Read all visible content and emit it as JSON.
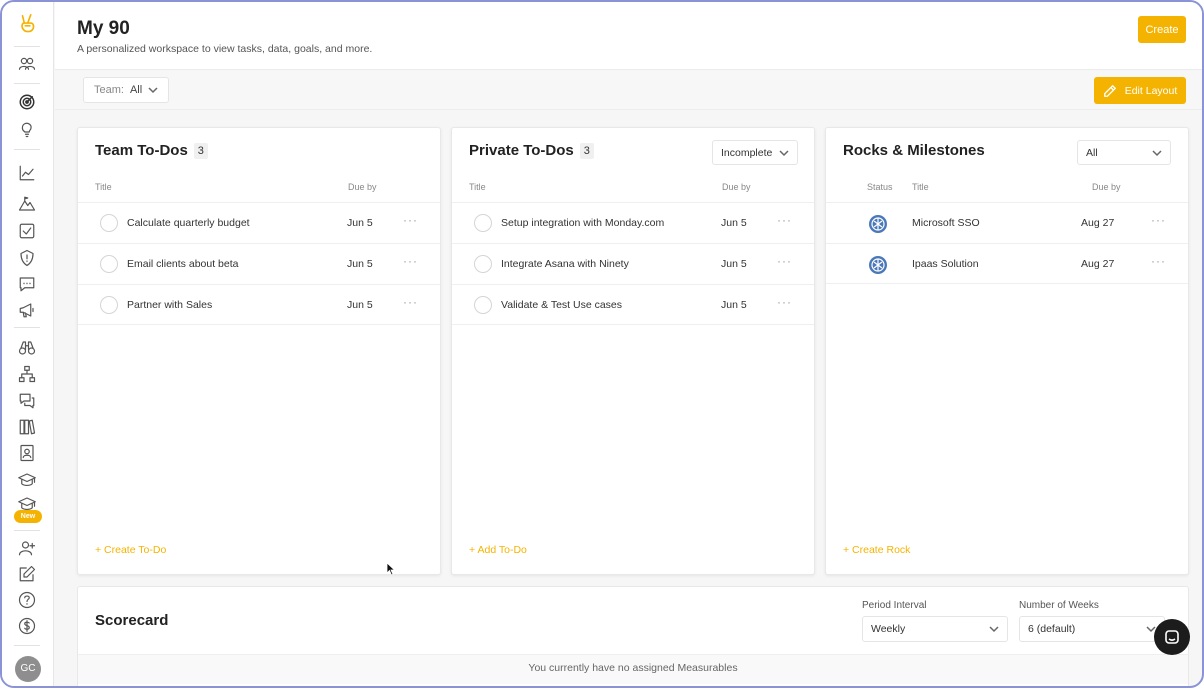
{
  "header": {
    "title": "My 90",
    "subtitle": "A personalized workspace to view tasks, data, goals, and more.",
    "create_label": "Create"
  },
  "filter": {
    "team_label": "Team:",
    "team_value": "All",
    "edit_layout_label": "Edit Layout"
  },
  "sidebar": {
    "new_badge": "New",
    "avatar_initials": "GC"
  },
  "team_todos": {
    "title": "Team To-Dos",
    "count": "3",
    "col_title": "Title",
    "col_due": "Due by",
    "rows": [
      {
        "title": "Calculate quarterly budget",
        "due": "Jun 5"
      },
      {
        "title": "Email clients about beta",
        "due": "Jun 5"
      },
      {
        "title": "Partner with Sales",
        "due": "Jun 5"
      }
    ],
    "add_label": "+ Create To-Do"
  },
  "private_todos": {
    "title": "Private To-Dos",
    "count": "3",
    "filter_value": "Incomplete",
    "col_title": "Title",
    "col_due": "Due by",
    "rows": [
      {
        "title": "Setup integration with Monday.com",
        "due": "Jun 5"
      },
      {
        "title": "Integrate Asana with Ninety",
        "due": "Jun 5"
      },
      {
        "title": "Validate & Test Use cases",
        "due": "Jun 5"
      }
    ],
    "add_label": "+ Add To-Do"
  },
  "rocks": {
    "title": "Rocks & Milestones",
    "filter_value": "All",
    "col_status": "Status",
    "col_title": "Title",
    "col_due": "Due by",
    "rows": [
      {
        "title": "Microsoft SSO",
        "due": "Aug 27"
      },
      {
        "title": "Ipaas Solution",
        "due": "Aug 27"
      }
    ],
    "add_label": "+ Create Rock"
  },
  "scorecard": {
    "title": "Scorecard",
    "period_label": "Period Interval",
    "period_value": "Weekly",
    "weeks_label": "Number of Weeks",
    "weeks_value": "6 (default)",
    "empty_text": "You currently have no assigned Measurables"
  },
  "colors": {
    "accent": "#f5b301",
    "frame": "#8a93d6",
    "status_icon": "#4a78b8"
  },
  "icons": [
    "peace-logo-icon",
    "people-icon",
    "target-icon",
    "lightbulb-icon",
    "line-chart-icon",
    "mountain-icon",
    "checkbox-icon",
    "shield-alert-icon",
    "chat-bubble-icon",
    "megaphone-icon",
    "binoculars-icon",
    "org-chart-icon",
    "discussion-icon",
    "books-icon",
    "contact-card-icon",
    "graduation-cap-icon",
    "graduation-cap-new-icon",
    "add-user-icon",
    "edit-note-icon",
    "help-icon",
    "dollar-icon",
    "pencil-icon",
    "chat-launcher-icon"
  ]
}
